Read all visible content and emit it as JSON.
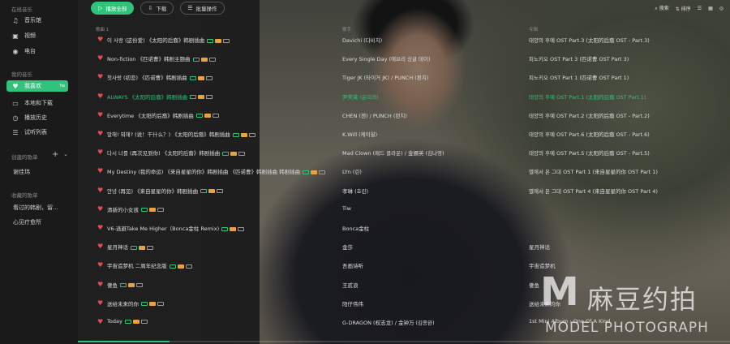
{
  "colors": {
    "accent": "#31c27c",
    "heart": "#e84b4b"
  },
  "sidebar": {
    "section_online": "在线音乐",
    "online_items": [
      {
        "label": "音乐馆",
        "icon": "music-note-icon"
      },
      {
        "label": "视频",
        "icon": "video-icon"
      },
      {
        "label": "电台",
        "icon": "radio-icon"
      }
    ],
    "section_mine": "我的音乐",
    "mine_items": [
      {
        "label": "我喜欢",
        "icon": "heart-icon",
        "tag": "ha",
        "active": true
      },
      {
        "label": "本地和下载",
        "icon": "computer-icon"
      },
      {
        "label": "播放历史",
        "icon": "clock-icon"
      },
      {
        "label": "试听列表",
        "icon": "list-icon"
      }
    ],
    "section_created": "创建的歌单",
    "created_items": [
      "谢佳玮"
    ],
    "section_collected": "收藏的歌单",
    "collected_items": [
      "看过的韩剧，留...",
      "心见疗愈所"
    ]
  },
  "toolbar": {
    "play_all": "播放全部",
    "download": "下载",
    "batch": "批量操作"
  },
  "right_tools": {
    "search": "搜索",
    "sort": "排序"
  },
  "columns": {
    "title": "歌曲 1",
    "artist": "歌手",
    "album": "专辑"
  },
  "songs": [
    {
      "title": "이 사랑 (这份爱) 《太阳的后裔》韩剧插曲",
      "artist": "Davichi (다비치)",
      "album": "태양의 후예 OST Part.3 (太阳的后裔 OST - Part.3)"
    },
    {
      "title": "Non-fiction 《匹诺曹》韩剧主题曲",
      "artist": "Every Single Day (에브리 싱글 데이)",
      "album": "피노키오 OST Part 3 (匹诺曹 OST Part 3)"
    },
    {
      "title": "첫사랑 (初恋) 《匹诺曹》韩剧插曲",
      "artist": "Tiger JK (타이거 JK) / PUNCH (펀치)",
      "album": "피노키오 OST Part 1 (匹诺曹 OST Part 1)"
    },
    {
      "title": "ALWAYS 《太阳的后裔》韩剧插曲",
      "artist": "尹美莱 (윤미래)",
      "album": "태양의 후예 OST Part.1 (太阳的后裔 OST Part.1)",
      "active": true
    },
    {
      "title": "Everytime 《太阳的后裔》韩剧插曲",
      "artist": "CHEN (첸) / PUNCH (펀치)",
      "album": "태양의 후예 OST Part.2 (太阳的后裔 OST - Part.2)"
    },
    {
      "title": "말해! 뭐해? (说！干什么？) 《太阳的后裔》韩剧插曲",
      "artist": "K.Will (케이윌)",
      "album": "태양의 후예 OST Part.6 (太阳的后裔 OST - Part.6)"
    },
    {
      "title": "다시 너를 (再次见到你) 《太阳的后裔》韩剧插曲",
      "artist": "Mad Clown (매드 클라운) / 金娜英 (김나영)",
      "album": "태양의 후예 OST Part.5 (太阳的后裔 OST - Part.5)"
    },
    {
      "title": "My Destiny (我的命运) 《来自星星的你》韩剧插曲 《匹诺曹》韩剧插曲 韩剧插曲",
      "artist": "LYn (린)",
      "album": "별에서 온 그대 OST Part 1 (来自星星的你 OST Part 1)"
    },
    {
      "title": "안녕 (再见) 《来自星星的你》韩剧插曲",
      "artist": "孝琳 (효린)",
      "album": "별에서 온 그대 OST Part 4 (来自星星的你 OST Part 4)"
    },
    {
      "title": "清新的小女孩",
      "artist": "Tiw",
      "album": ""
    },
    {
      "title": "V6-逃避Take Me Higher（Bonca金柱 Remix)",
      "artist": "Bonca金柱",
      "album": ""
    },
    {
      "title": "星月神话",
      "artist": "金莎",
      "album": "星月神话"
    },
    {
      "title": "宇宙造梦机 二周年纪念版",
      "artist": "吾画诗听",
      "album": "宇宙造梦机"
    },
    {
      "title": "傻鱼",
      "artist": "王贰浪",
      "album": "傻鱼"
    },
    {
      "title": "送给未来的你",
      "artist": "阳仔伟伟",
      "album": "送给未来的你"
    },
    {
      "title": "Today",
      "artist": "G-DRAGON (权志龙) / 金钟万 (김종완)",
      "album": "1st Mini Album : One Of A Kind"
    }
  ],
  "progress": 0.14,
  "watermark": {
    "logo": "M",
    "cn": "麻豆约拍",
    "en": "MODEL PHOTOGRAPH"
  }
}
